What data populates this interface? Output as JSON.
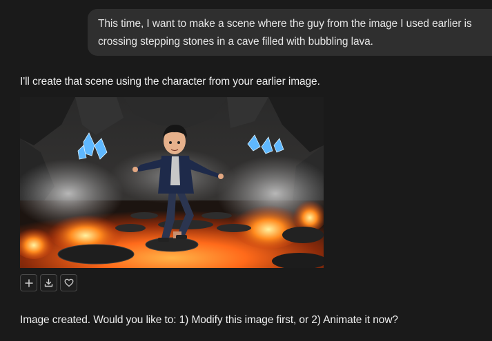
{
  "conversation": {
    "user_message": "This time, I want to make a scene where the guy from the image I used earlier is crossing stepping stones in a cave filled with bubbling lava.",
    "assistant_intro": "I'll create that scene using the character from your earlier image.",
    "assistant_followup": "Image created. Would you like to: 1) Modify this image first, or 2) Animate it now?"
  },
  "image_actions": [
    {
      "name": "add-button",
      "icon": "plus-icon"
    },
    {
      "name": "download-button",
      "icon": "download-icon"
    },
    {
      "name": "like-button",
      "icon": "heart-icon"
    }
  ],
  "colors": {
    "background": "#1a1a1a",
    "bubble": "#2f2f2f",
    "text": "#ececec",
    "lava": "#ff6a1a"
  }
}
